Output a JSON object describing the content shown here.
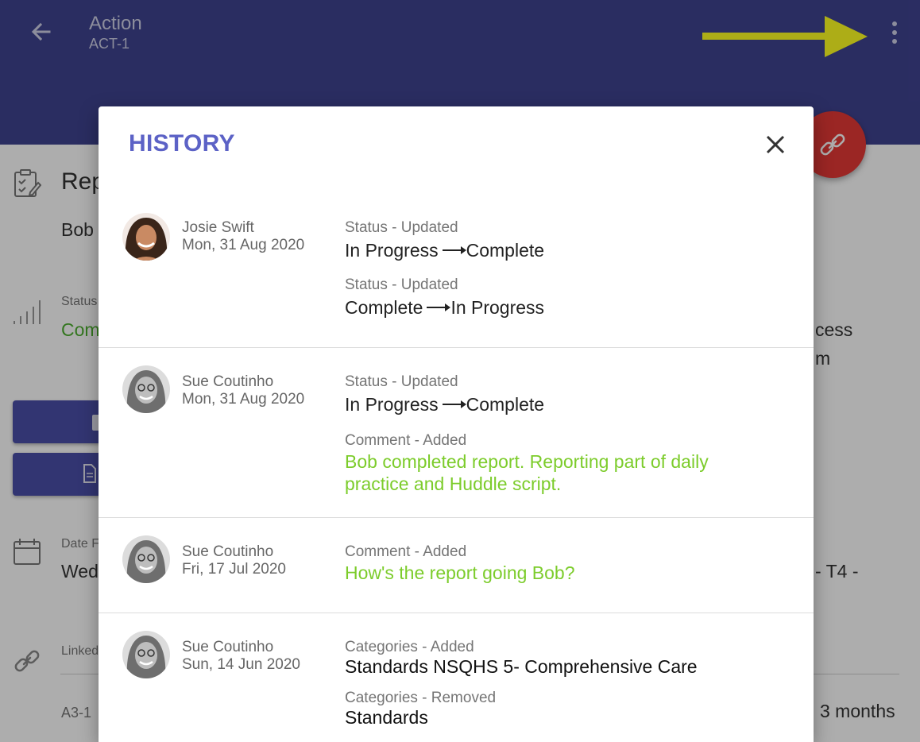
{
  "header": {
    "title": "Action",
    "subtitle": "ACT-1",
    "background_color": "#3f4390"
  },
  "background": {
    "section_title": "Rep",
    "assignee": "Bob",
    "status_label": "Status",
    "status_value": "Com",
    "right_text_1": "cess",
    "right_text_2": "m",
    "date_label": "Date F",
    "date_value": "Wed",
    "right_text_3": "- T4 -",
    "linked_label": "Linked",
    "linked_id": "A3-1",
    "linked_when": "3 months"
  },
  "dialog": {
    "title": "HISTORY",
    "title_color": "#5c62c6",
    "comment_color": "#7ccc2b",
    "entries": [
      {
        "user": "Josie Swift",
        "date": "Mon, 31 Aug 2020",
        "changes": [
          {
            "label": "Status - Updated",
            "from": "In Progress",
            "to": "Complete"
          },
          {
            "label": "Status - Updated",
            "from": "Complete",
            "to": "In Progress"
          }
        ]
      },
      {
        "user": "Sue Coutinho",
        "date": "Mon, 31 Aug 2020",
        "changes": [
          {
            "label": "Status - Updated",
            "from": "In Progress",
            "to": "Complete"
          },
          {
            "label": "Comment - Added",
            "text": "Bob completed report. Reporting part of daily practice and Huddle script."
          }
        ]
      },
      {
        "user": "Sue Coutinho",
        "date": "Fri, 17 Jul 2020",
        "changes": [
          {
            "label": "Comment - Added",
            "text": "How's the report going Bob?"
          }
        ]
      },
      {
        "user": "Sue Coutinho",
        "date": "Sun, 14 Jun 2020",
        "changes": [
          {
            "label": "Categories - Added",
            "text": "Standards NSQHS 5- Comprehensive Care"
          },
          {
            "label": "Categories - Removed",
            "text": "Standards"
          }
        ]
      }
    ]
  }
}
